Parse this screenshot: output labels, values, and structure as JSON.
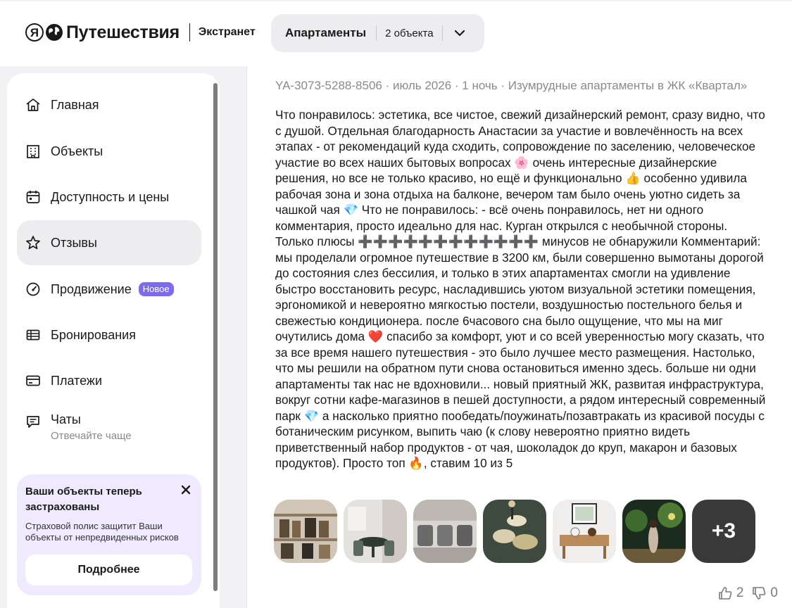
{
  "header": {
    "logo_ya": "Я",
    "logo_text": "Путешествия",
    "extranet": "Экстранет",
    "object_name": "Апартаменты",
    "object_count": "2 объекта"
  },
  "sidebar": {
    "items": [
      {
        "label": "Главная",
        "icon": "home-icon"
      },
      {
        "label": "Объекты",
        "icon": "building-icon"
      },
      {
        "label": "Доступность и цены",
        "icon": "calendar-icon"
      },
      {
        "label": "Отзывы",
        "icon": "star-icon",
        "active": true
      },
      {
        "label": "Продвижение",
        "icon": "speedometer-icon",
        "badge": "Новое"
      },
      {
        "label": "Бронирования",
        "icon": "table-icon"
      },
      {
        "label": "Платежи",
        "icon": "card-icon"
      },
      {
        "label": "Чаты",
        "icon": "chat-icon",
        "sub": "Отвечайте чаще"
      }
    ],
    "promo": {
      "title": "Ваши объекты теперь застрахованы",
      "text": "Страховой полис защитит Ваши объекты от непредвиденных рисков",
      "button": "Подробнее"
    }
  },
  "review": {
    "meta": "YA-3073-5288-8506 · июль 2026 · 1 ночь · Изумрудные апартаменты в ЖК «Квартал»",
    "text": "Что понравилось: эстетика, все чистое, свежий дизайнерский ремонт, сразу видно, что с душой. Отдельная благодарность Анастасии за участие и вовлечённость на всех этапах - от рекомендаций куда сходить, сопровождение по заселению, человеческое участие во всех наших бытовых вопросах 🌸 очень интересные дизайнерские решения, но все не только красиво, но ещё и функционально 👍 особенно удивила рабочая зона и зона отдыха на балконе, вечером там было очень уютно сидеть за чашкой чая 💎 Что не понравилось: - всё очень понравилось, нет ни одного комментария, просто идеально для нас. Курган открылся с необычной стороны. Только плюсы ➕➕➕➕➕➕➕➕➕➕➕➕ минусов не обнаружили Комментарий: мы проделали огромное путешествие в 3200 км, были совершенно вымотаны дорогой до состояния слез бессилия, и только в этих апартаментах смогли на удивление быстро восстановить ресурс, насладившись уютом визуальной эстетики помещения, эргономикой и невероятно мягкостью постели, воздушностью постельного белья и свежестью кондиционера. после 6часового сна было ощущение, что мы на миг очутились дома ❤️ спасибо за комфорт, уют и со всей уверенностью могу сказать, что за все время нашего путешествия - это было лучшее место размещения. Настолько, что мы решили на обратном пути снова остановиться именно здесь. больше ни одни апартаменты так нас не вдохновили... новый приятный ЖК, развитая инфраструктура, вокруг сотни кафе-магазинов в пешей доступности, а рядом интересный современный парк 💎 а насколько приятно пообедать/поужинать/позавтракать из красивой посуды с ботаническим рисунком, выпить чаю (к слову невероятно приятно видеть приветственный набор продуктов - от чая, шоколадок до круп, макарон и базовых продуктов). Просто топ 🔥, ставим 10 из 5",
    "photos": [
      "photo-shelves",
      "photo-dining",
      "photo-kitchen-cups",
      "photo-dinner-table",
      "photo-breakfast-tray",
      "photo-night-park"
    ],
    "more_photos": "+3",
    "likes": "2",
    "dislikes": "0"
  },
  "colors": {
    "accent_purple": "#7c6bf2",
    "promo_bg": "#efeafd",
    "active_bg": "#ededf0"
  }
}
